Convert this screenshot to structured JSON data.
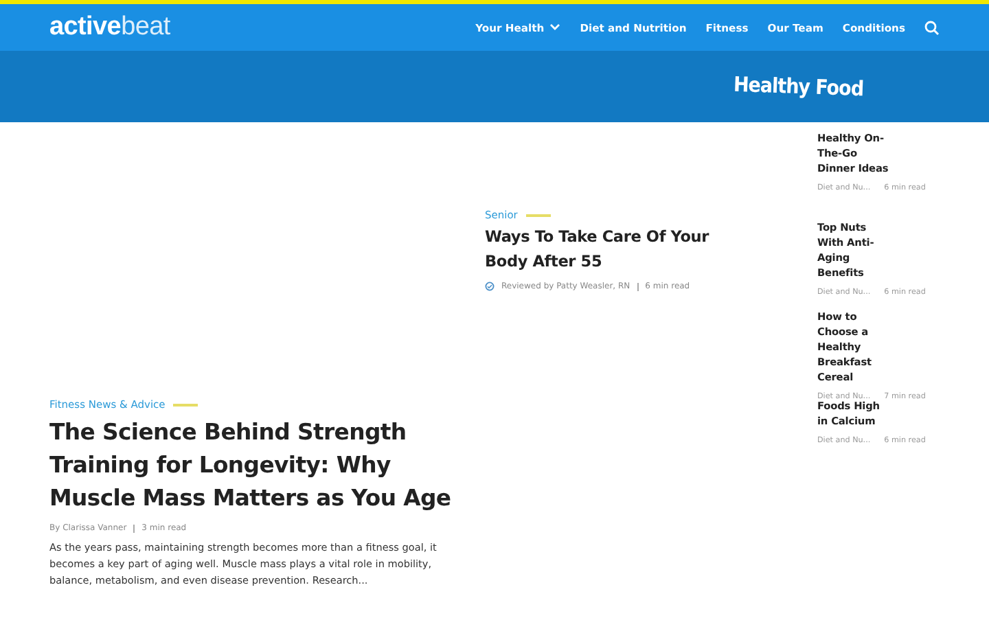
{
  "logo": {
    "strong": "active",
    "light": "beat"
  },
  "nav": [
    {
      "label": "Your Health",
      "dropdown": true
    },
    {
      "label": "Diet and Nutrition",
      "dropdown": false
    },
    {
      "label": "Fitness",
      "dropdown": false
    },
    {
      "label": "Our Team",
      "dropdown": false
    },
    {
      "label": "Conditions",
      "dropdown": false
    }
  ],
  "banner": {
    "title": "Healthy Food"
  },
  "featured": {
    "category": "Fitness News & Advice",
    "title": "The Science Behind Strength Training for Longevity: Why Muscle Mass Matters as You Age",
    "author": "By Clarissa Vanner",
    "read_time": "3 min read",
    "excerpt": "As the years pass, maintaining strength becomes more than a fitness goal, it becomes a key part of aging well. Muscle mass plays a vital role in mobility, balance, metabolism, and even disease prevention. Research..."
  },
  "secondary": {
    "category": "Senior",
    "title": "Ways To Take Care Of Your Body After 55",
    "reviewer": "Reviewed by Patty Weasler, RN",
    "read_time": "6 min read"
  },
  "sidebar": [
    {
      "title": "Healthy On-The-Go Dinner Ideas",
      "category": "Diet and Nu...",
      "read_time": "6 min read"
    },
    {
      "title": "Top Nuts With Anti-Aging Benefits",
      "category": "Diet and Nu...",
      "read_time": "6 min read"
    },
    {
      "title": "How to Choose a Healthy Breakfast Cereal",
      "category": "Diet and Nu...",
      "read_time": "7 min read"
    },
    {
      "title": "Foods High in Calcium",
      "category": "Diet and Nu...",
      "read_time": "6 min read"
    }
  ]
}
